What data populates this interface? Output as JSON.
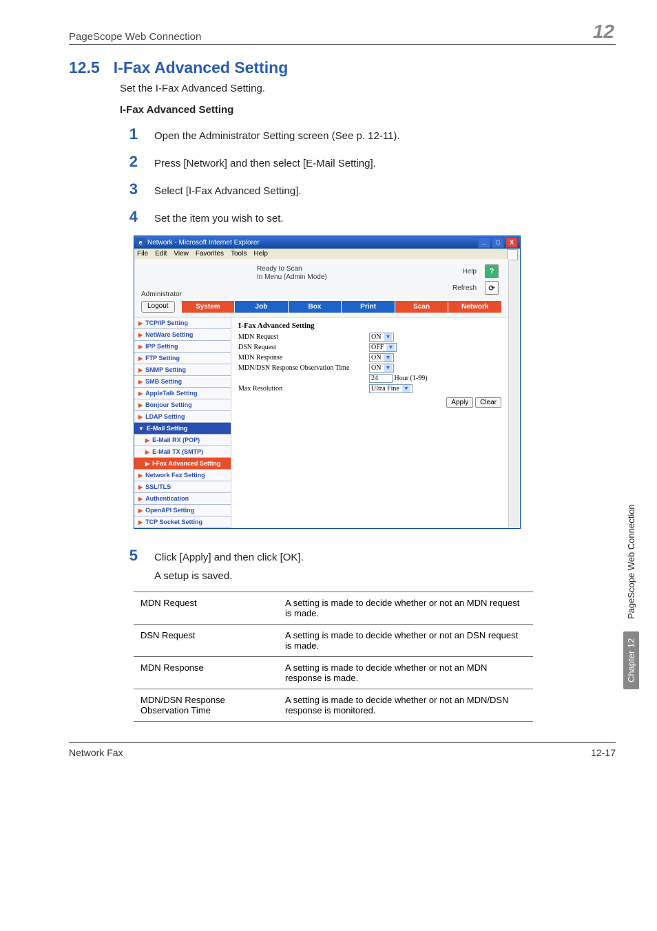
{
  "header": {
    "title": "PageScope Web Connection",
    "chapter_num": "12"
  },
  "section": {
    "num": "12.5",
    "title": "I-Fax Advanced Setting"
  },
  "intro": "Set the I-Fax Advanced Setting.",
  "subheading": "I-Fax Advanced Setting",
  "steps": {
    "1": "Open the Administrator Setting screen (See p. 12-11).",
    "2": "Press [Network] and then select [E-Mail Setting].",
    "3": "Select [I-Fax Advanced Setting].",
    "4": "Set the item you wish to set.",
    "5": "Click [Apply] and then click [OK].",
    "5b": "A setup is saved."
  },
  "ie": {
    "title": "Network - Microsoft Internet Explorer",
    "menu": {
      "file": "File",
      "edit": "Edit",
      "view": "View",
      "fav": "Favorites",
      "tools": "Tools",
      "help": "Help"
    },
    "status": {
      "ready": "Ready to Scan",
      "mode": "In Menu (Admin Mode)"
    },
    "help_label": "Help",
    "refresh_label": "Refresh",
    "admin_label": "Administrator",
    "logout": "Logout",
    "tabs": {
      "system": "System",
      "job": "Job",
      "box": "Box",
      "print": "Print",
      "scan": "Scan",
      "network": "Network"
    },
    "sidebar": [
      {
        "k": "tcpip",
        "label": "TCP/IP Setting"
      },
      {
        "k": "netware",
        "label": "NetWare Setting"
      },
      {
        "k": "ipp",
        "label": "IPP Setting"
      },
      {
        "k": "ftp",
        "label": "FTP Setting"
      },
      {
        "k": "snmp",
        "label": "SNMP Setting"
      },
      {
        "k": "smb",
        "label": "SMB Setting"
      },
      {
        "k": "appletalk",
        "label": "AppleTalk Setting"
      },
      {
        "k": "bonjour",
        "label": "Bonjour Setting"
      },
      {
        "k": "ldap",
        "label": "LDAP Setting"
      },
      {
        "k": "email",
        "label": "E-Mail Setting",
        "open": true
      },
      {
        "k": "emailrx",
        "label": "E-Mail RX (POP)",
        "sub": true
      },
      {
        "k": "emailtx",
        "label": "E-Mail TX (SMTP)",
        "sub": true
      },
      {
        "k": "ifaxadv",
        "label": "I-Fax Advanced Setting",
        "sub": true,
        "sel": true
      },
      {
        "k": "netfax",
        "label": "Network Fax Setting"
      },
      {
        "k": "ssl",
        "label": "SSL/TLS"
      },
      {
        "k": "auth",
        "label": "Authentication"
      },
      {
        "k": "openapi",
        "label": "OpenAPI Setting"
      },
      {
        "k": "tcpsock",
        "label": "TCP Socket Setting"
      }
    ],
    "form": {
      "title": "I-Fax Advanced Setting",
      "mdn_req": {
        "label": "MDN Request",
        "value": "ON"
      },
      "dsn_req": {
        "label": "DSN Request",
        "value": "OFF"
      },
      "mdn_resp": {
        "label": "MDN Response",
        "value": "ON"
      },
      "obs": {
        "label": "MDN/DSN Response Observation Time",
        "value": "ON"
      },
      "hour": {
        "value": "24",
        "unit": "Hour (1-99)"
      },
      "maxres": {
        "label": "Max Resolution",
        "value": "Ultra Fine"
      },
      "apply": "Apply",
      "clear": "Clear"
    }
  },
  "table": {
    "rows": [
      {
        "name": "MDN Request",
        "desc": "A setting is made to decide whether or not an MDN request is made."
      },
      {
        "name": "DSN Request",
        "desc": "A setting is made to decide whether or not an DSN request is made."
      },
      {
        "name": "MDN Response",
        "desc": "A setting is made to decide whether or not an MDN response is made."
      },
      {
        "name": "MDN/DSN Response Observation Time",
        "desc": "A setting is made to decide whether or not an MDN/DSN response is monitored."
      }
    ]
  },
  "sidetab": {
    "text": "PageScope Web Connection",
    "chapter": "Chapter 12"
  },
  "footer": {
    "left": "Network Fax",
    "right": "12-17"
  }
}
